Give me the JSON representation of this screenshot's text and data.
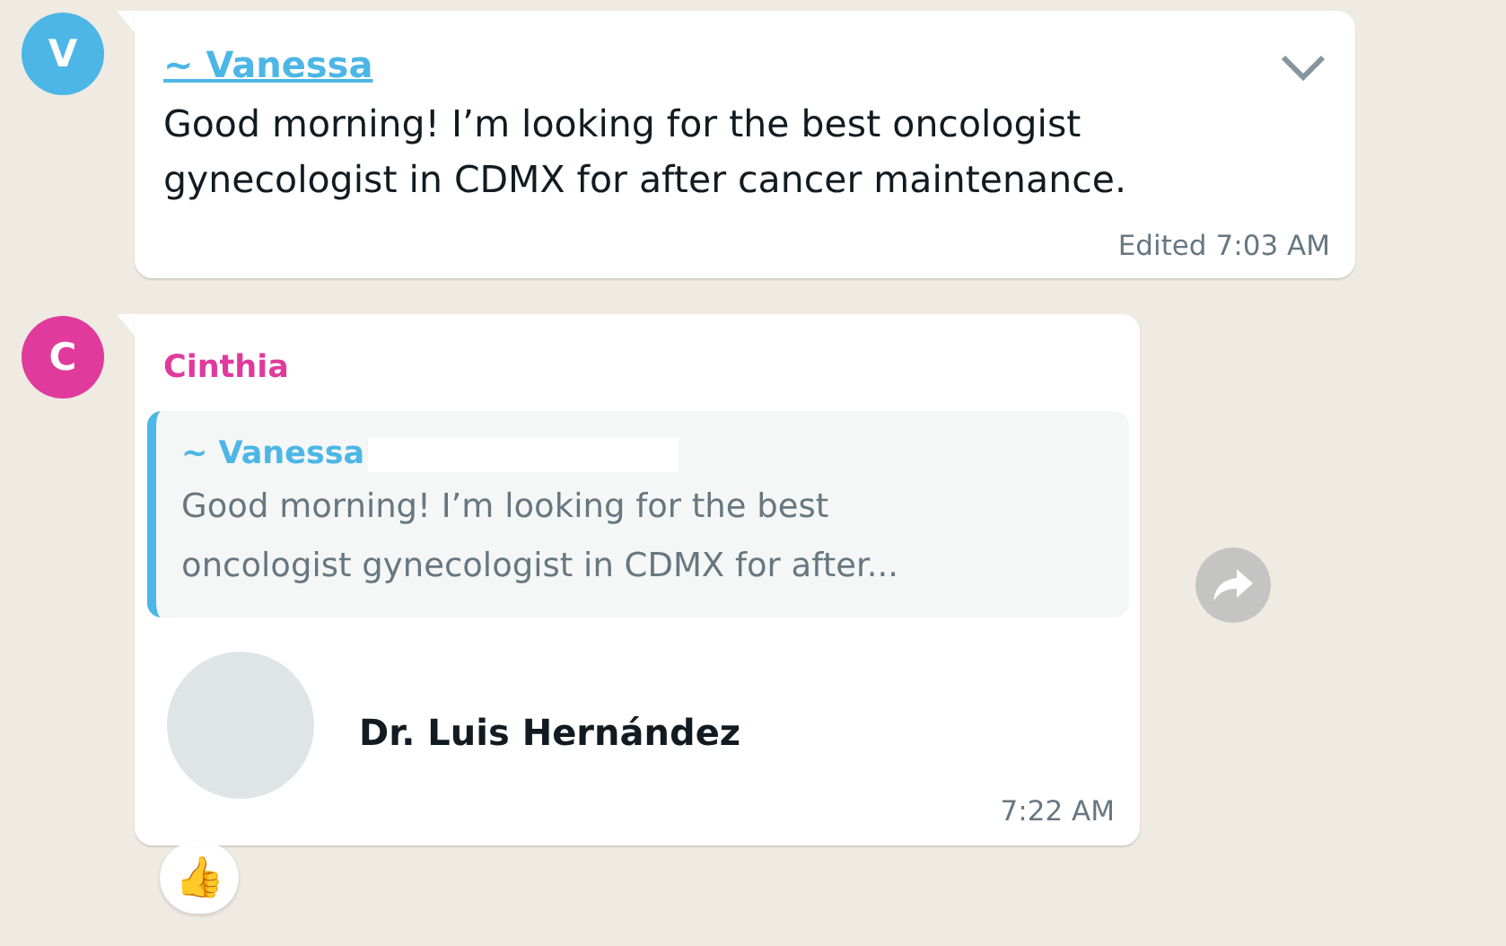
{
  "messages": [
    {
      "kind": "text",
      "avatar_letter": "V",
      "color": "#4cb6e6",
      "sender": "~ Vanessa",
      "sender_link": true,
      "text": "Good morning! I’m looking for the best oncologist gynecologist in CDMX for after cancer maintenance.",
      "edited_label": "Edited",
      "time": "7:03 AM",
      "menu_open": false
    },
    {
      "kind": "contact",
      "avatar_letter": "C",
      "color": "#e03a9c",
      "sender": "Cinthia",
      "sender_link": false,
      "quote": {
        "sender": "~ Vanessa",
        "color": "#4cb6e6",
        "text": "Good morning! I’m looking for the best oncologist gynecologist in CDMX for after..."
      },
      "contact_name": "Dr. Luis Hernández",
      "time": "7:22 AM",
      "reaction": "👍"
    }
  ]
}
